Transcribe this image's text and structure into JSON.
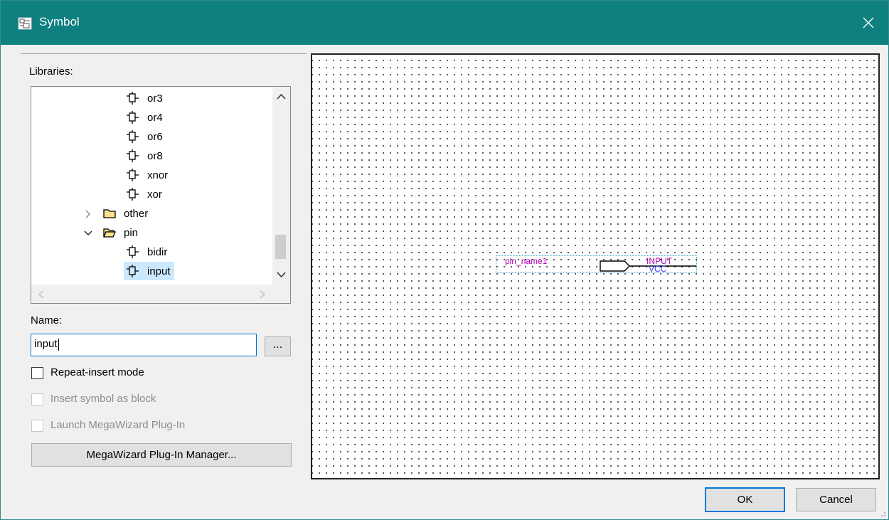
{
  "window": {
    "title": "Symbol",
    "close_glyph": "✕",
    "title_bar_color": "#0e8080"
  },
  "left": {
    "libraries_label": "Libraries:",
    "tree_items": [
      {
        "label": "or3",
        "kind": "symbol",
        "icon": "symbol-icon"
      },
      {
        "label": "or4",
        "kind": "symbol",
        "icon": "symbol-icon"
      },
      {
        "label": "or6",
        "kind": "symbol",
        "icon": "symbol-icon"
      },
      {
        "label": "or8",
        "kind": "symbol",
        "icon": "symbol-icon"
      },
      {
        "label": "xnor",
        "kind": "symbol",
        "icon": "symbol-icon"
      },
      {
        "label": "xor",
        "kind": "symbol",
        "icon": "symbol-icon"
      },
      {
        "label": "other",
        "kind": "folder",
        "state": "collapsed",
        "icon": "folder-icon"
      },
      {
        "label": "pin",
        "kind": "folder",
        "state": "expanded",
        "icon": "folder-open-icon"
      },
      {
        "label": "bidir",
        "kind": "symbol",
        "icon": "symbol-icon"
      },
      {
        "label": "input",
        "kind": "symbol",
        "icon": "symbol-icon",
        "selected": true
      }
    ],
    "name_label": "Name:",
    "name_value": "input",
    "browse_label": "...",
    "repeat_insert": {
      "label": "Repeat-insert mode",
      "checked": false,
      "enabled": true
    },
    "insert_block": {
      "label": "Insert symbol as block",
      "checked": false,
      "enabled": false
    },
    "launch_mega": {
      "label": "Launch MegaWizard Plug-In",
      "checked": false,
      "enabled": false
    },
    "megawizard_button": "MegaWizard Plug-In Manager..."
  },
  "preview": {
    "pin_name": "pin_name1",
    "pin_type": "INPUT",
    "default_value": "VCC",
    "label_color": "#b000b0",
    "value_color": "#4040ff"
  },
  "footer": {
    "ok_label": "OK",
    "cancel_label": "Cancel"
  }
}
